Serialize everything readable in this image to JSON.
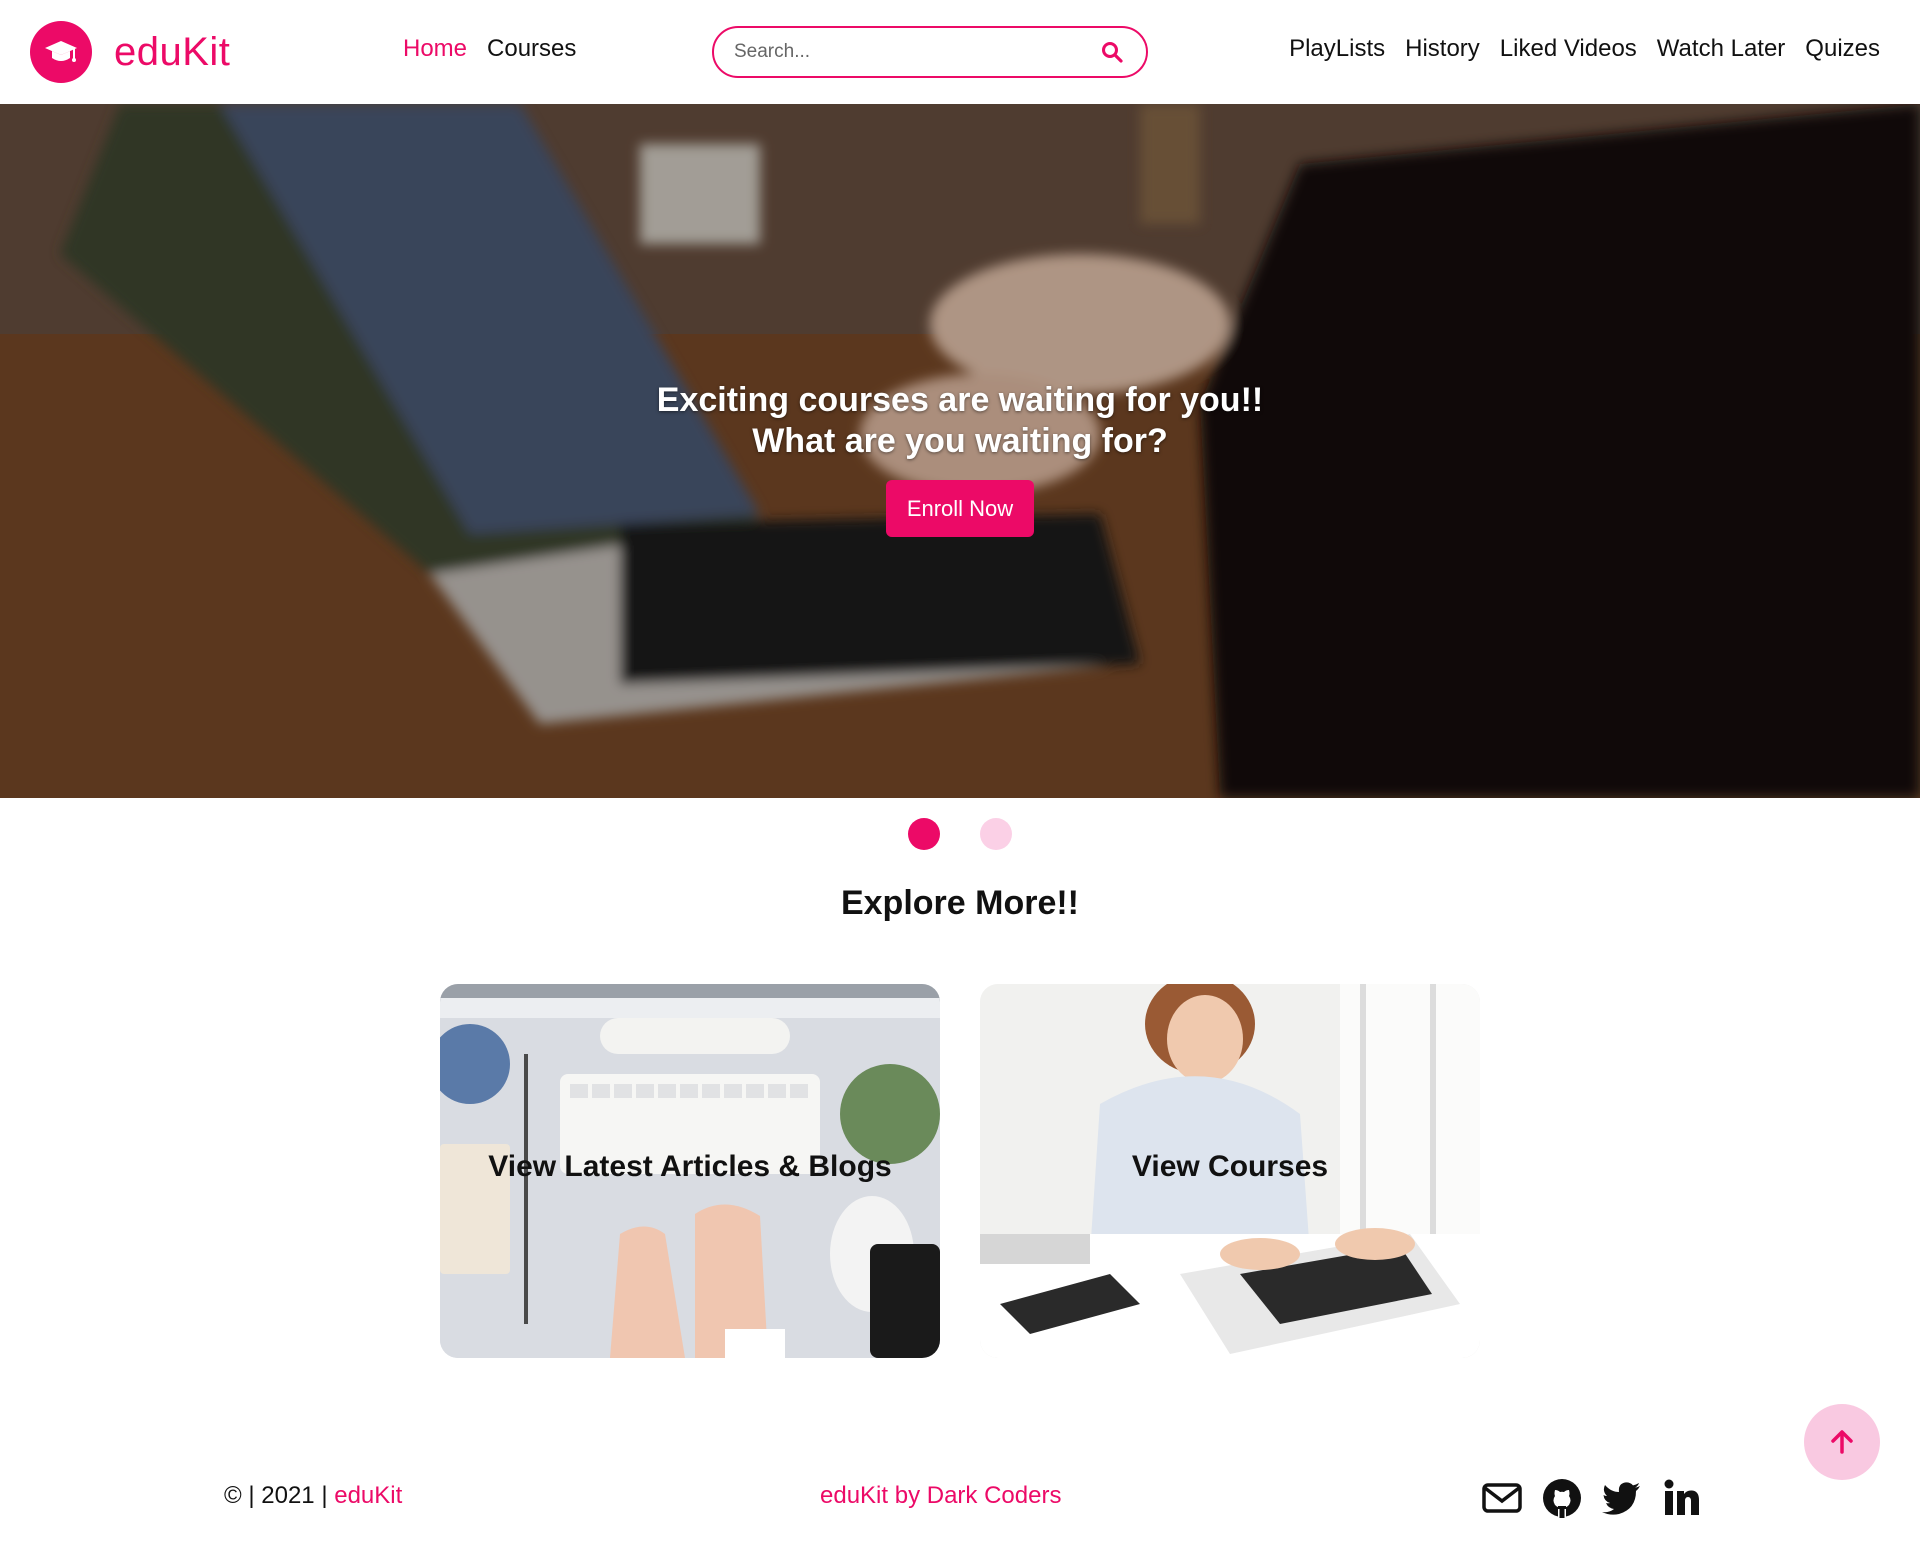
{
  "brand": {
    "name": "eduKit",
    "logo_icon": "graduation-cap-icon",
    "accent_color": "#ec0a67"
  },
  "nav": {
    "left": [
      {
        "label": "Home",
        "active": true
      },
      {
        "label": "Courses",
        "active": false
      }
    ],
    "right": [
      {
        "label": "PlayLists"
      },
      {
        "label": "History"
      },
      {
        "label": "Liked Videos"
      },
      {
        "label": "Watch Later"
      },
      {
        "label": "Quizes"
      }
    ]
  },
  "search": {
    "placeholder": "Search...",
    "value": "",
    "icon": "search-icon"
  },
  "hero": {
    "line1": "Exciting courses are waiting for you!!",
    "line2": "What are you waiting for?",
    "cta_label": "Enroll Now"
  },
  "carousel": {
    "slides": 2,
    "active_index": 0
  },
  "explore": {
    "title": "Explore More!!",
    "cards": [
      {
        "label": "View Latest Articles & Blogs"
      },
      {
        "label": "View Courses"
      }
    ]
  },
  "back_to_top": {
    "icon": "arrow-up-icon"
  },
  "footer": {
    "copyright_prefix": "© | 2021 | ",
    "copyright_brand": "eduKit",
    "credit": "eduKit by Dark Coders",
    "social_icons": [
      "mail-icon",
      "github-icon",
      "twitter-icon",
      "linkedin-icon"
    ]
  }
}
